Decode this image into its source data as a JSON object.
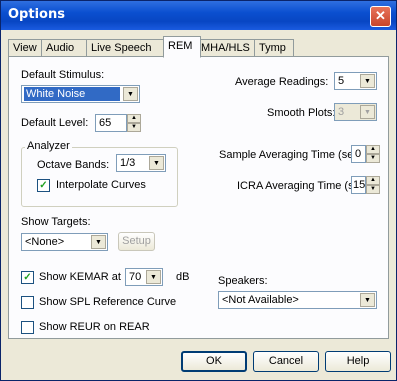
{
  "window": {
    "title": "Options"
  },
  "tabs": [
    {
      "label": "View"
    },
    {
      "label": "Audio"
    },
    {
      "label": "Live Speech"
    },
    {
      "label": "REM",
      "active": true
    },
    {
      "label": "MHA/HLS"
    },
    {
      "label": "Tymp"
    }
  ],
  "left": {
    "default_stimulus_label": "Default Stimulus:",
    "default_stimulus_value": "White Noise",
    "default_level_label": "Default Level:",
    "default_level_value": "65",
    "analyzer_title": "Analyzer",
    "octave_bands_label": "Octave Bands:",
    "octave_bands_value": "1/3",
    "interpolate_label": "Interpolate Curves",
    "interpolate_checked": true,
    "show_targets_label": "Show Targets:",
    "show_targets_value": "<None>",
    "setup_label": "Setup",
    "show_kemar_label": "Show KEMAR at",
    "show_kemar_checked": true,
    "kemar_value": "70",
    "kemar_unit": "dB",
    "show_spl_label": "Show SPL Reference Curve",
    "show_spl_checked": false,
    "show_reur_label": "Show REUR on REAR",
    "show_reur_checked": false
  },
  "right": {
    "average_readings_label": "Average Readings:",
    "average_readings_value": "5",
    "smooth_plots_label": "Smooth Plots:",
    "smooth_plots_value": "3",
    "sample_averaging_label": "Sample Averaging Time (sec):",
    "sample_averaging_value": "0",
    "icra_averaging_label": "ICRA Averaging Time (sec):",
    "icra_averaging_value": "15",
    "speakers_label": "Speakers:",
    "speakers_value": "<Not Available>"
  },
  "buttons": {
    "ok": "OK",
    "cancel": "Cancel",
    "help": "Help"
  },
  "icons": {
    "close": "close-icon",
    "dropdown": "chevron-down-icon",
    "spin_up": "spin-up-icon",
    "spin_down": "spin-down-icon",
    "check": "checkmark-icon"
  },
  "colors": {
    "titlebar": "#0a4fd0",
    "selection": "#316ac5",
    "window_bg": "#ece9d8"
  }
}
